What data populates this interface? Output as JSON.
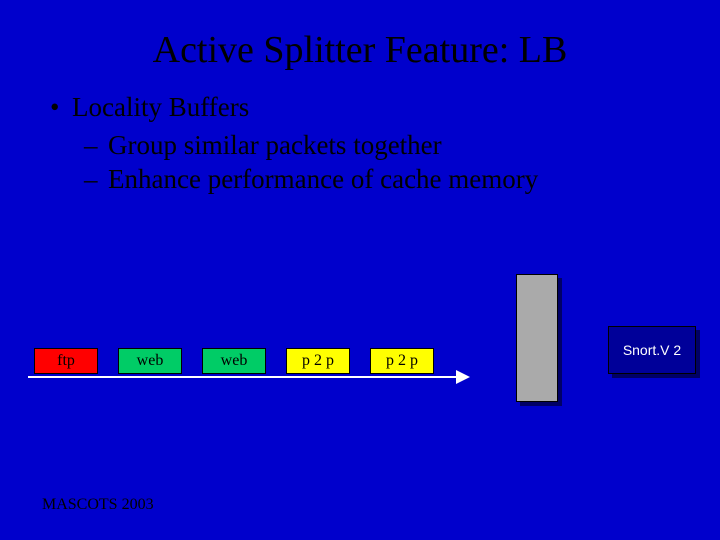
{
  "title": "Active Splitter Feature: LB",
  "bullet_main": "Locality Buffers",
  "sub_points": {
    "a": "Group similar packets together",
    "b": "Enhance performance of cache memory"
  },
  "packets": {
    "p1": "ftp",
    "p2": "web",
    "p3": "web",
    "p4": "p 2 p",
    "p5": "p 2 p"
  },
  "snort_label": "Snort.V 2",
  "footer": "MASCOTS 2003"
}
